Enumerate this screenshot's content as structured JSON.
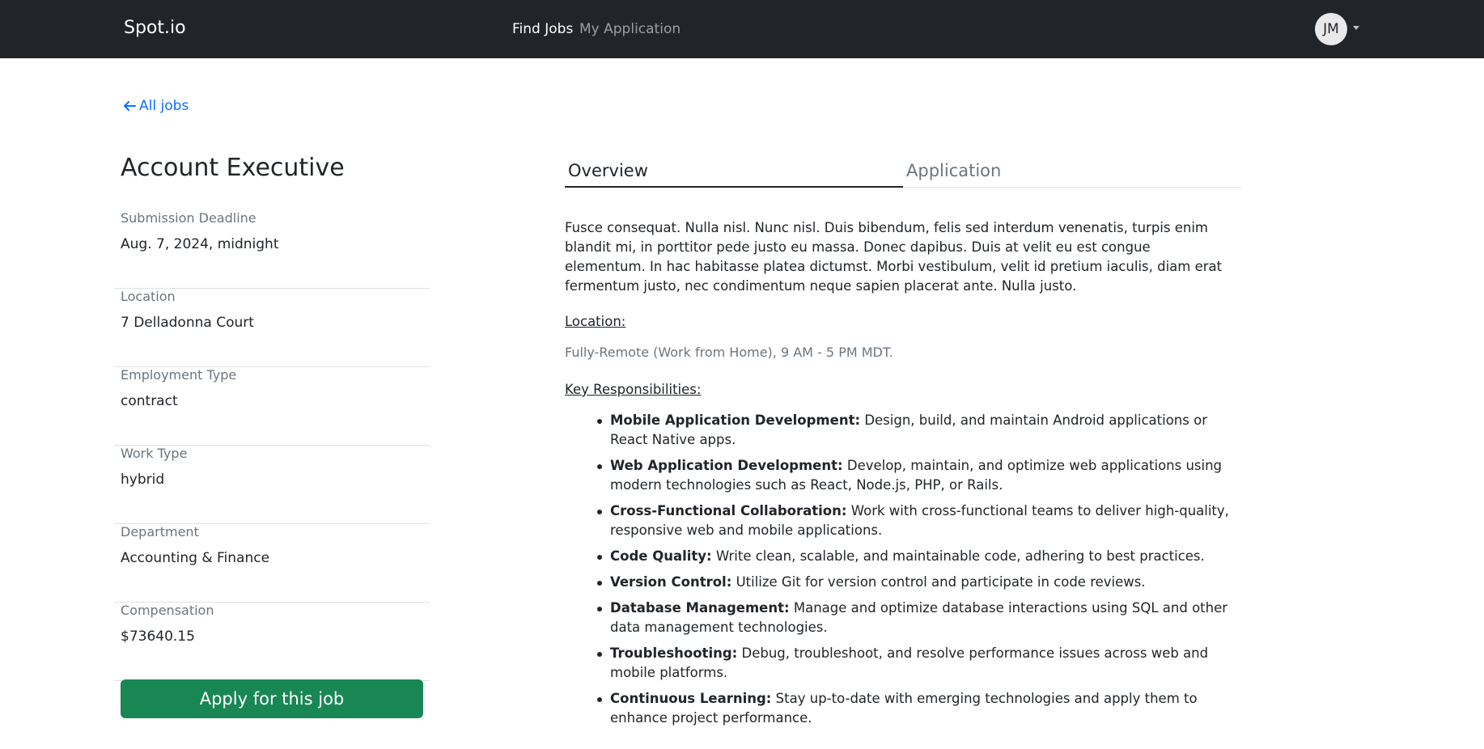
{
  "navbar": {
    "brand": "Spot.io",
    "links": [
      {
        "label": "Find Jobs",
        "active": true
      },
      {
        "label": "My Application",
        "active": false
      }
    ],
    "avatar_initials": "JM"
  },
  "back_link": {
    "label": "All jobs"
  },
  "job": {
    "title": "Account Executive",
    "details": [
      {
        "label": "Submission Deadline",
        "value": "Aug. 7, 2024, midnight"
      },
      {
        "label": "Location",
        "value": "7 Delladonna Court"
      },
      {
        "label": "Employment Type",
        "value": "contract"
      },
      {
        "label": "Work Type",
        "value": "hybrid"
      },
      {
        "label": "Department",
        "value": "Accounting & Finance"
      },
      {
        "label": "Compensation",
        "value": "$73640.15"
      }
    ],
    "apply_label": "Apply for this job"
  },
  "tabs": [
    {
      "label": "Overview",
      "active": true
    },
    {
      "label": "Application",
      "active": false
    }
  ],
  "overview": {
    "intro": "Fusce consequat. Nulla nisl. Nunc nisl. Duis bibendum, felis sed interdum venenatis, turpis enim blandit mi, in porttitor pede justo eu massa. Donec dapibus. Duis at velit eu est congue elementum. In hac habitasse platea dictumst. Morbi vestibulum, velit id pretium iaculis, diam erat fermentum justo, nec condimentum neque sapien placerat ante. Nulla justo.",
    "location_heading": "Location:",
    "location_text": "Fully-Remote (Work from Home), 9 AM - 5 PM MDT.",
    "responsibilities_heading": "Key Responsibilities:",
    "responsibilities": [
      {
        "title": "Mobile Application Development:",
        "text": "Design, build, and maintain Android applications or React Native apps."
      },
      {
        "title": "Web Application Development:",
        "text": "Develop, maintain, and optimize web applications using modern technologies such as React, Node.js, PHP, or Rails."
      },
      {
        "title": "Cross-Functional Collaboration:",
        "text": "Work with cross-functional teams to deliver high-quality, responsive web and mobile applications."
      },
      {
        "title": "Code Quality:",
        "text": "Write clean, scalable, and maintainable code, adhering to best practices."
      },
      {
        "title": "Version Control:",
        "text": "Utilize Git for version control and participate in code reviews."
      },
      {
        "title": "Database Management:",
        "text": "Manage and optimize database interactions using SQL and other data management technologies."
      },
      {
        "title": "Troubleshooting:",
        "text": "Debug, troubleshoot, and resolve performance issues across web and mobile platforms."
      },
      {
        "title": "Continuous Learning:",
        "text": "Stay up-to-date with emerging technologies and apply them to enhance project performance."
      }
    ]
  },
  "colors": {
    "navbar_bg": "#212529",
    "link_blue": "#0d6efd",
    "apply_green": "#198754",
    "muted_gray": "#6c757d"
  },
  "icons": {
    "back": "arrow-left-icon",
    "avatar_menu": "caret-down-icon"
  }
}
